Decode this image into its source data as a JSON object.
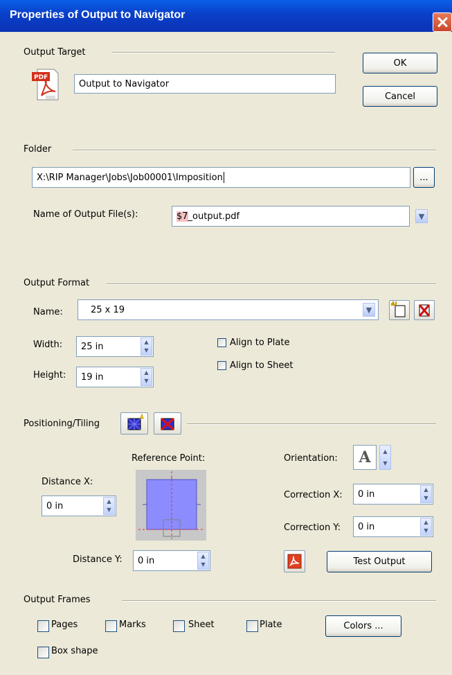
{
  "window": {
    "title": "Properties of Output to Navigator",
    "close_glyph": "✕"
  },
  "buttons": {
    "ok": "OK",
    "cancel": "Cancel",
    "test_output": "Test Output",
    "colors": "Colors ...",
    "browse": "..."
  },
  "output_target": {
    "label": "Output Target",
    "value": "Output to Navigator",
    "icon": "pdf-icon"
  },
  "folder": {
    "label": "Folder",
    "path": "X:\\RIP Manager\\Jobs\\Job00001\\Imposition"
  },
  "output_file": {
    "label": "Name of Output File(s):",
    "prefix": "$7",
    "suffix": "_output.pdf"
  },
  "output_format": {
    "label": "Output Format",
    "name_label": "Name:",
    "name_value": "25 x 19",
    "width_label": "Width:",
    "width_value": "25 in",
    "height_label": "Height:",
    "height_value": "19 in",
    "align_plate": "Align to Plate",
    "align_sheet": "Align to Sheet"
  },
  "positioning": {
    "label": "Positioning/Tiling",
    "reference_label": "Reference Point:",
    "distance_x_label": "Distance X:",
    "distance_x_value": "0 in",
    "distance_y_label": "Distance Y:",
    "distance_y_value": "0 in",
    "orientation_label": "Orientation:",
    "orientation_glyph": "A",
    "correction_x_label": "Correction X:",
    "correction_x_value": "0 in",
    "correction_y_label": "Correction Y:",
    "correction_y_value": "0 in"
  },
  "frames": {
    "label": "Output Frames",
    "pages": "Pages",
    "marks": "Marks",
    "sheet": "Sheet",
    "plate": "Plate",
    "box_shape": "Box shape"
  },
  "colors": {
    "title_bar": "#0A46D6",
    "dialog_bg": "#ECE9D8",
    "field_border": "#7F9DB9",
    "reference_fill": "#8C8CFF"
  }
}
